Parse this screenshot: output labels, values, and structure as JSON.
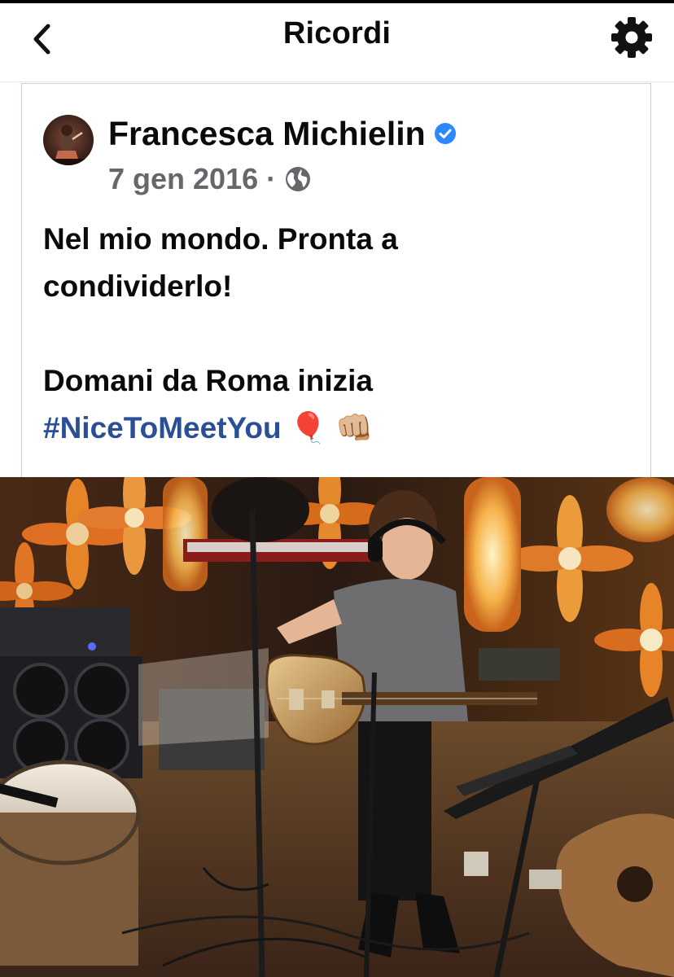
{
  "header": {
    "title": "Ricordi",
    "back_icon": "chevron-left-icon",
    "settings_icon": "gear-icon"
  },
  "post": {
    "author": "Francesca Michielin",
    "verified": true,
    "date": "7 gen 2016",
    "separator": "·",
    "privacy_icon": "globe-icon",
    "text_lines": [
      "Nel mio mondo. Pronta a",
      "condividerlo!",
      "",
      "Domani da Roma inizia"
    ],
    "hashtag": "#NiceToMeetYou",
    "emoji": [
      "🎈",
      "👊🏼"
    ]
  },
  "colors": {
    "verified_badge": "#2d88ff",
    "hashtag": "#2a4f96",
    "meta_text": "#65676b"
  }
}
